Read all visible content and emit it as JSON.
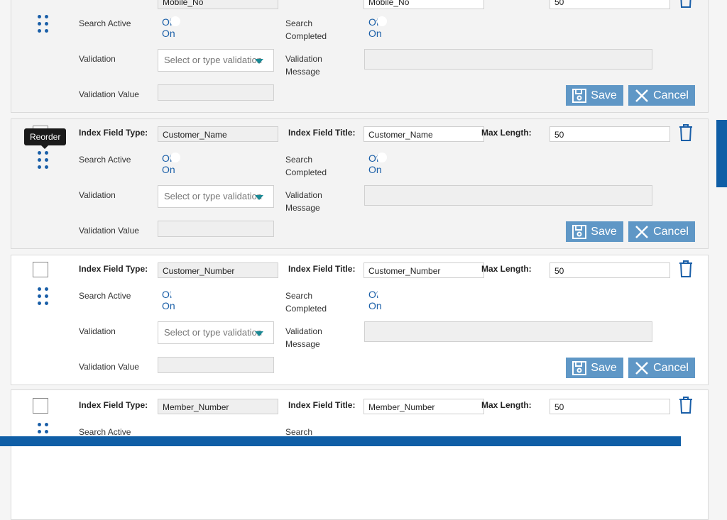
{
  "labels": {
    "index_field_type": "Index Field Type:",
    "index_field_title": "Index Field Title:",
    "max_length": "Max Length:",
    "search_active": "Search Active",
    "search_completed_1": "Search",
    "search_completed_2": "Completed",
    "validation": "Validation",
    "validation_message_1": "Validation",
    "validation_message_2": "Message",
    "validation_value": "Validation Value",
    "toggle_off": "Of",
    "toggle_on": "On",
    "save": "Save",
    "cancel": "Cancel",
    "select_placeholder": "Select or type validation"
  },
  "tooltip": "Reorder",
  "rows": [
    {
      "field_type": "Mobile_No",
      "field_title": "Mobile_No",
      "max_length": "50"
    },
    {
      "field_type": "Customer_Name",
      "field_title": "Customer_Name",
      "max_length": "50"
    },
    {
      "field_type": "Customer_Number",
      "field_title": "Customer_Number",
      "max_length": "50"
    },
    {
      "field_type": "Member_Number",
      "field_title": "Member_Number",
      "max_length": "50"
    }
  ],
  "colors": {
    "accent": "#1a5fa8",
    "button": "#5f97c6",
    "scroll": "#0f5ea6"
  }
}
